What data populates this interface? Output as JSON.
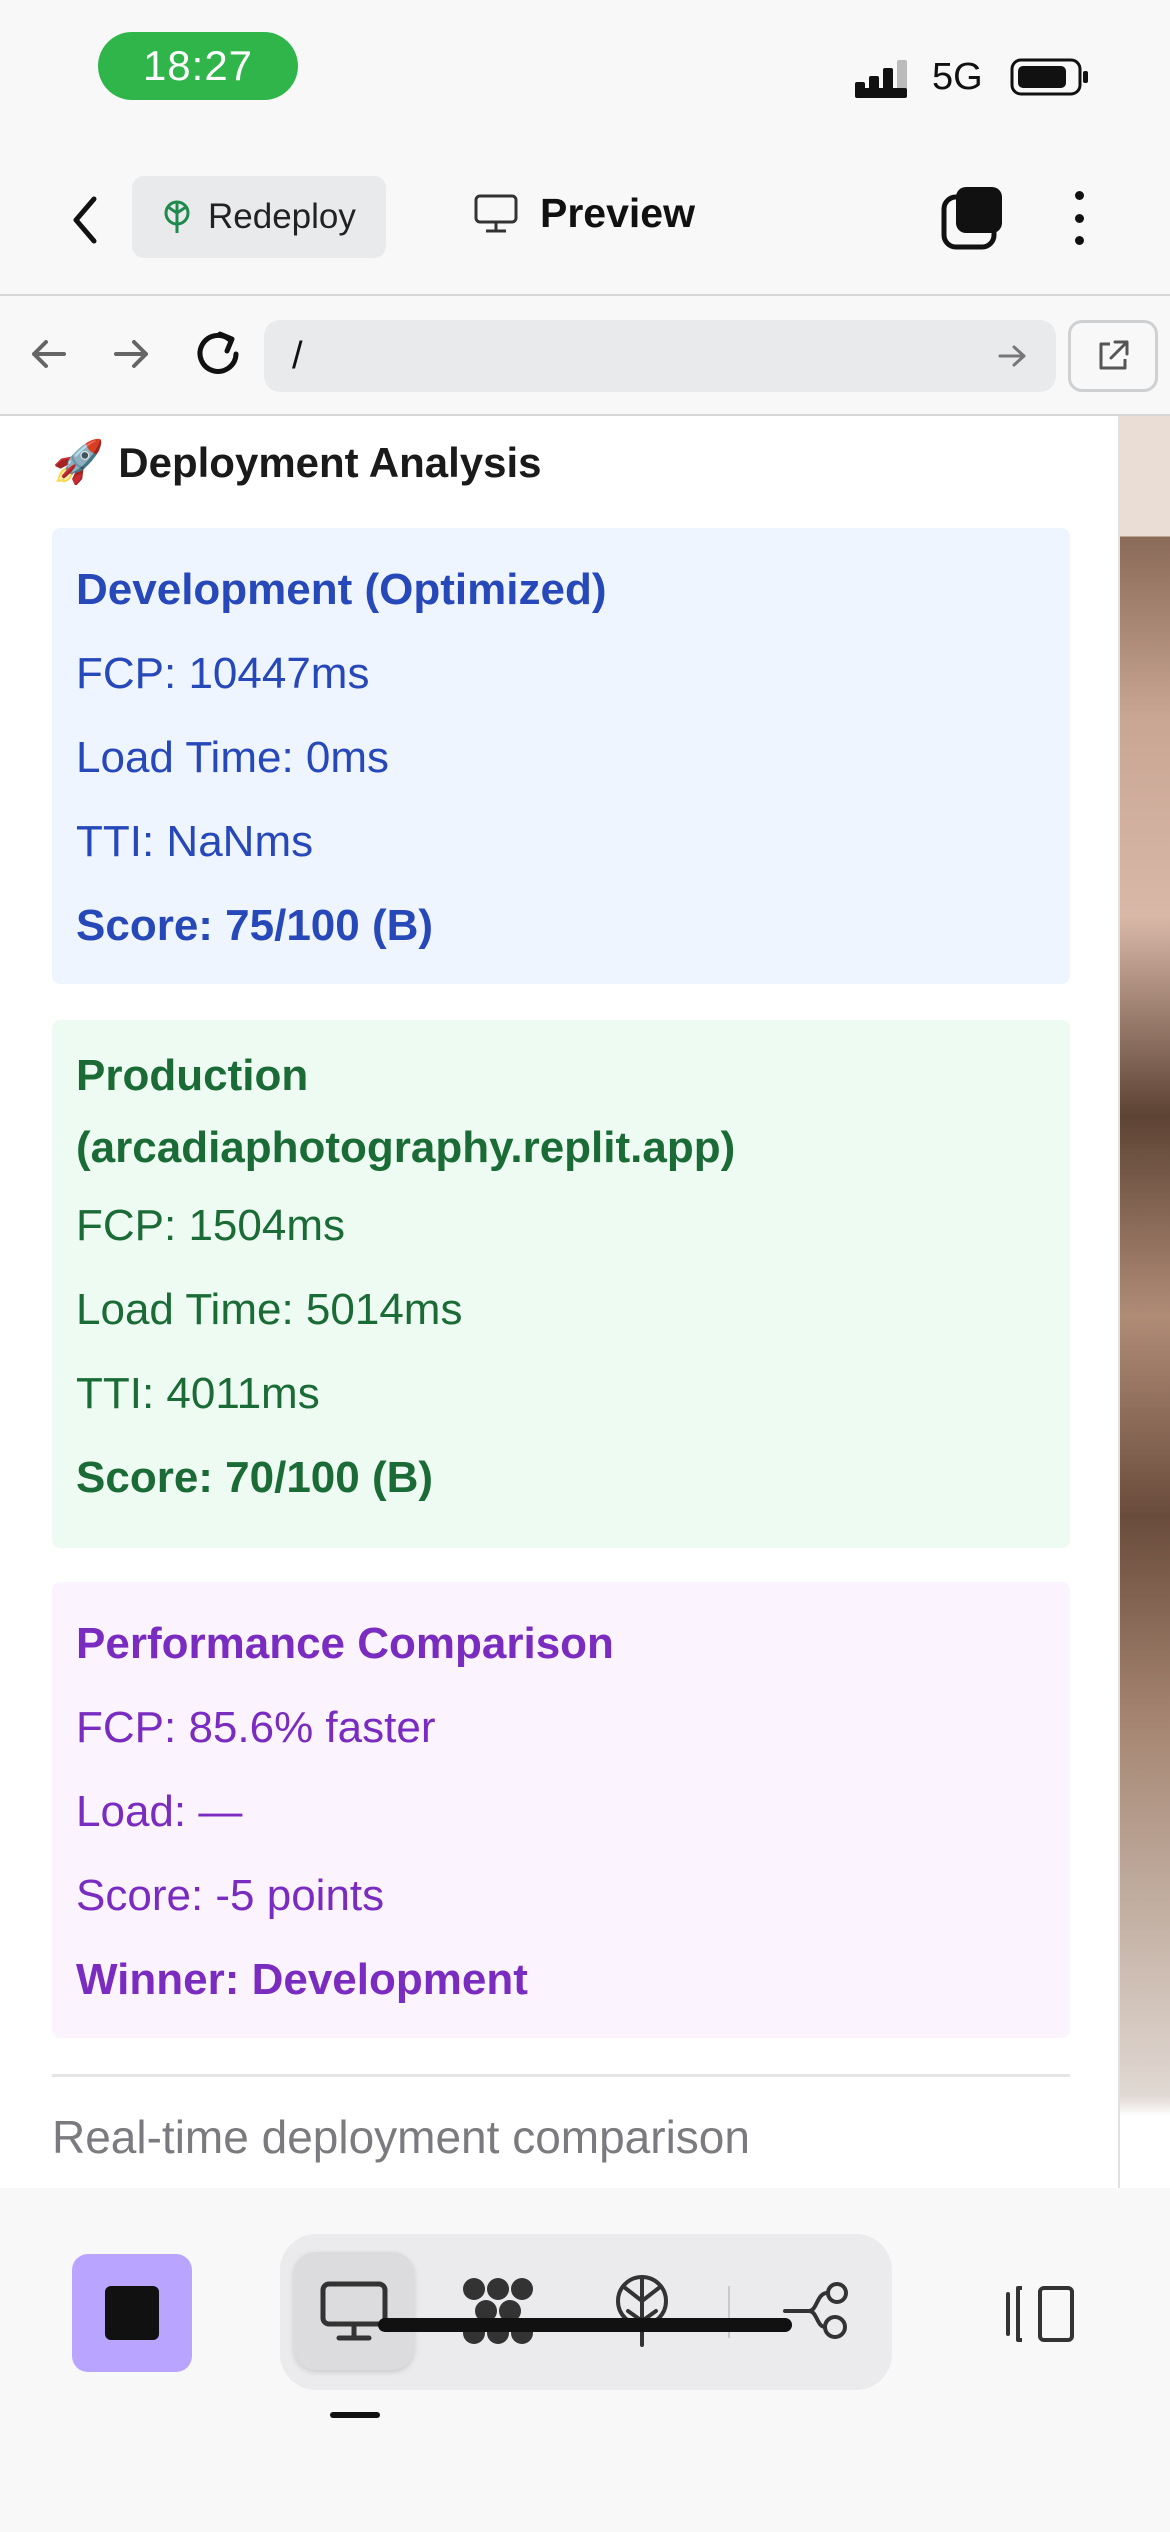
{
  "status_bar": {
    "time": "18:27",
    "network": "5G"
  },
  "top_bar": {
    "redeploy_label": "Redeploy",
    "preview_label": "Preview"
  },
  "url_bar": {
    "url": "/"
  },
  "content": {
    "heading": "Deployment Analysis",
    "heading_emoji": "🚀",
    "development": {
      "title": "Development (Optimized)",
      "fcp": "FCP: 10447ms",
      "load_time": "Load Time: 0ms",
      "tti": "TTI: NaNms",
      "score": "Score: 75/100 (B)"
    },
    "production": {
      "title_line1": "Production",
      "title_line2": "(arcadiaphotography.replit.app)",
      "fcp": "FCP: 1504ms",
      "load_time": "Load Time: 5014ms",
      "tti": "TTI: 4011ms",
      "score": "Score: 70/100 (B)"
    },
    "comparison": {
      "title": "Performance Comparison",
      "fcp": "FCP: 85.6% faster",
      "load": "Load: —",
      "score": "Score: -5 points",
      "winner": "Winner: Development"
    },
    "footer_note": "Real-time deployment comparison"
  },
  "colors": {
    "dev_bg": "#eff5ff",
    "dev_text": "#2748b8",
    "prod_bg": "#edfbf2",
    "prod_text": "#1a6b36",
    "cmp_bg": "#fbf4ff",
    "cmp_text": "#7a2bc0",
    "stop_button": "#b9a4ff",
    "time_pill": "#2fb54a"
  },
  "toolbar": {
    "icons": [
      "stop-icon",
      "monitor-icon",
      "workspace-icon",
      "deploy-icon",
      "git-icon",
      "panels-icon"
    ]
  }
}
